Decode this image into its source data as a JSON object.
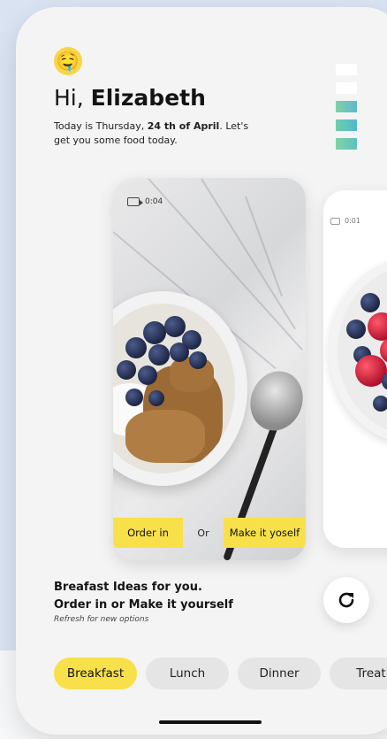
{
  "greeting": {
    "prefix": "Hi,",
    "name": "Elizabeth",
    "emoji": "🤤"
  },
  "subtitle": {
    "pre": "Today is Thursday,",
    "date": "24 th of April",
    "post": ". Let's get you some food today."
  },
  "swatches": [
    "#ffffff",
    "#ffffff",
    "#7fcfb6",
    "#5fc3bd",
    "#7fcfb6"
  ],
  "cards": [
    {
      "duration": "0:04",
      "order_label": "Order in",
      "or_label": "Or",
      "make_label": "Make it yoself"
    },
    {
      "duration": "0:01"
    }
  ],
  "ideas": {
    "line1": "Breafast Ideas for you.",
    "line2": "Order in or Make it yourself",
    "note": "Refresh for new options"
  },
  "tabs": [
    {
      "label": "Breakfast",
      "active": true
    },
    {
      "label": "Lunch",
      "active": false
    },
    {
      "label": "Dinner",
      "active": false
    },
    {
      "label": "Treat",
      "active": false
    }
  ],
  "colors": {
    "accent": "#f8e04a",
    "background": "#d9e3f1"
  }
}
